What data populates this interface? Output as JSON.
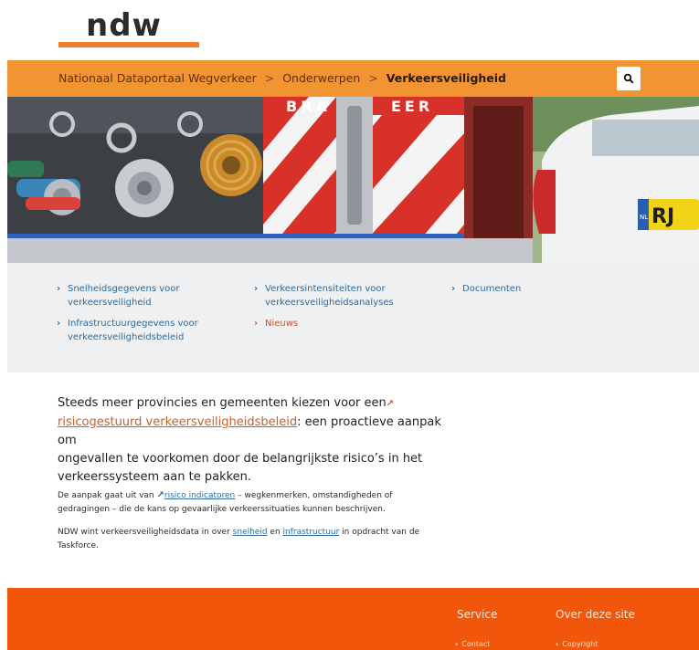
{
  "logo": {
    "text": "ndw"
  },
  "breadcrumb": {
    "items": [
      "Nationaal Dataportaal Wegverkeer",
      "Onderwerpen",
      "Verkeersveiligheid"
    ],
    "separator": ">"
  },
  "search": {
    "icon": "search-icon"
  },
  "hero": {
    "truck_lettering": "BRA   EER",
    "plate_text": "RJ",
    "plate_country": "NL"
  },
  "links": [
    {
      "label_line1": "Snelheidsgegevens voor",
      "label_line2": "verkeersveiligheid"
    },
    {
      "label_line1": "Verkeersintensiteiten voor",
      "label_line2": "verkeersveiligheidsanalyses"
    },
    {
      "label_line1": "Documenten",
      "label_line2": ""
    },
    {
      "label_line1": "Infrastructuurgegevens voor",
      "label_line2": "verkeersveiligheidsbeleid"
    },
    {
      "label_line1": "Nieuws",
      "label_line2": ""
    }
  ],
  "lead": {
    "line1": "Steeds meer provincies en gemeenten kiezen voor een",
    "link": "risicogestuurd verkeersveiligheidsbeleid",
    "after_link": ": een proactieve aanpak om",
    "line3": "ongevallen te voorkomen door de belangrijkste risico’s in het",
    "line4": "verkeerssysteem aan te pakken."
  },
  "para1": {
    "before": "De aanpak gaat uit van ",
    "link": "risico indicatoren",
    "after": " – wegkenmerken, omstandigheden of",
    "line2": "gedragingen – die de kans op gevaarlijke verkeerssituaties kunnen beschrijven."
  },
  "para2": {
    "before": "NDW wint verkeersveiligheidsdata in over ",
    "link1": "snelheid",
    "mid": " en ",
    "link2": "infrastructuur",
    "after": " in opdracht van de",
    "line2": "Taskforce."
  },
  "footer": {
    "col1_heading": "Service",
    "col2_heading": "Over deze site",
    "col1_link": "Contact",
    "col2_link": "Copyright"
  },
  "colors": {
    "brand_orange": "#f39433",
    "footer_orange": "#f2560b",
    "link_blue": "#2e6a9d",
    "link_orange": "#c8602d"
  }
}
